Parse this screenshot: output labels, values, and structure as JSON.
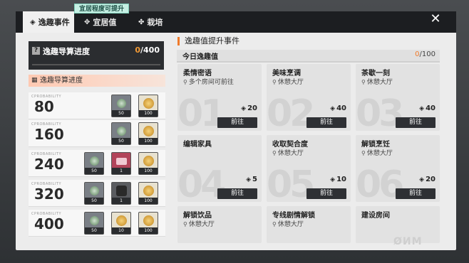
{
  "hint": "宜居程度可提升",
  "tabs": [
    {
      "label": "逸趣事件",
      "icon": "◈"
    },
    {
      "label": "宜居值",
      "icon": "✥"
    },
    {
      "label": "栽培",
      "icon": "✤"
    }
  ],
  "close_icon": "✕",
  "progress_panel": {
    "title": "逸趣导算进度",
    "current": "0",
    "total": "/400",
    "sub_title": "逸趣导算进度"
  },
  "rewards": [
    {
      "label": "CPROBABILITY",
      "value": "80",
      "items": [
        {
          "type": "plant",
          "qty": "50"
        },
        {
          "type": "coin",
          "qty": "100"
        }
      ]
    },
    {
      "label": "CPROBABILITY",
      "value": "160",
      "items": [
        {
          "type": "plant",
          "qty": "50"
        },
        {
          "type": "coin",
          "qty": "100"
        }
      ]
    },
    {
      "label": "CPROBABILITY",
      "value": "240",
      "items": [
        {
          "type": "plant",
          "qty": "50"
        },
        {
          "type": "ticket",
          "qty": "1"
        },
        {
          "type": "coin",
          "qty": "100"
        }
      ]
    },
    {
      "label": "CPROBABILITY",
      "value": "320",
      "items": [
        {
          "type": "plant",
          "qty": "50"
        },
        {
          "type": "dark",
          "qty": "1"
        },
        {
          "type": "coin",
          "qty": "100"
        }
      ]
    },
    {
      "label": "CPROBABILITY",
      "value": "400",
      "items": [
        {
          "type": "plant",
          "qty": "50"
        },
        {
          "type": "coin",
          "qty": "10"
        },
        {
          "type": "coin",
          "qty": "100"
        }
      ]
    }
  ],
  "section_title": "逸趣值提升事件",
  "today": {
    "label": "今日逸趣值",
    "current": "0",
    "total": "/100"
  },
  "events": [
    {
      "title": "柔情密语",
      "location": "多个房间可前往",
      "points": "20",
      "button": "前往",
      "wm": "01"
    },
    {
      "title": "美味烹调",
      "location": "休憩大厅",
      "points": "40",
      "button": "前往",
      "wm": "02"
    },
    {
      "title": "茶歇一刻",
      "location": "休憩大厅",
      "points": "40",
      "button": "前往",
      "wm": "03"
    },
    {
      "title": "编辑家具",
      "location": "",
      "points": "5",
      "button": "前往",
      "wm": "04"
    },
    {
      "title": "收取契合度",
      "location": "休憩大厅",
      "points": "10",
      "button": "前往",
      "wm": "05"
    },
    {
      "title": "解锁烹饪",
      "location": "休憩大厅",
      "points": "20",
      "button": "前往",
      "wm": "06"
    },
    {
      "title": "解锁饮品",
      "location": "休憩大厅",
      "points": "",
      "button": "",
      "wm": ""
    },
    {
      "title": "专线剧情解锁",
      "location": "休憩大厅",
      "points": "",
      "button": "",
      "wm": ""
    },
    {
      "title": "建设房间",
      "location": "",
      "points": "",
      "button": "",
      "wm": ""
    }
  ],
  "pin_icon": "⚲",
  "diamond_icon": "◈"
}
